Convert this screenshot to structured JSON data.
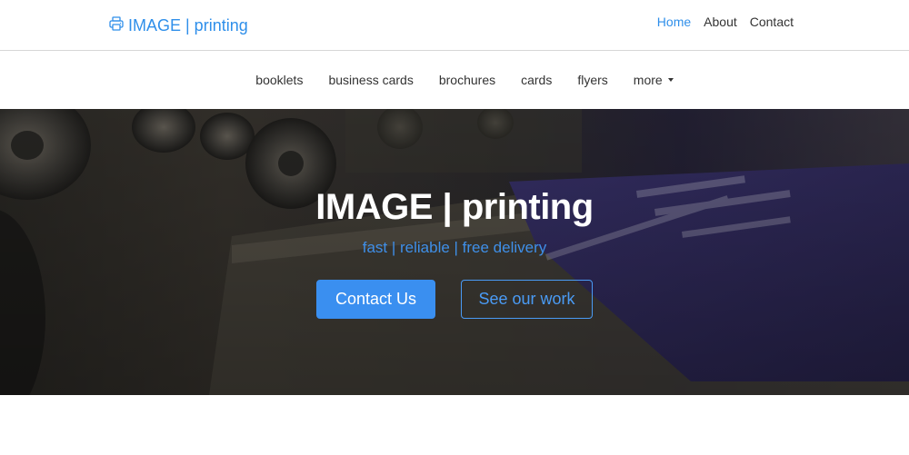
{
  "header": {
    "brand": "IMAGE | printing",
    "nav": [
      {
        "label": "Home"
      },
      {
        "label": "About"
      },
      {
        "label": "Contact"
      }
    ]
  },
  "categories": {
    "items": [
      {
        "label": "booklets"
      },
      {
        "label": "business cards"
      },
      {
        "label": "brochures"
      },
      {
        "label": "cards"
      },
      {
        "label": "flyers"
      }
    ],
    "more_label": "more"
  },
  "hero": {
    "title": "IMAGE | printing",
    "tagline": "fast | reliable | free delivery",
    "primary_button": "Contact Us",
    "secondary_button": "See our work"
  },
  "colors": {
    "accent": "#2f8fea",
    "primary_button": "#3a8ff0",
    "hero_overlay": "#2c2a26"
  },
  "icons": {
    "brand_icon": "printer-icon",
    "more_icon": "caret-down-icon"
  }
}
